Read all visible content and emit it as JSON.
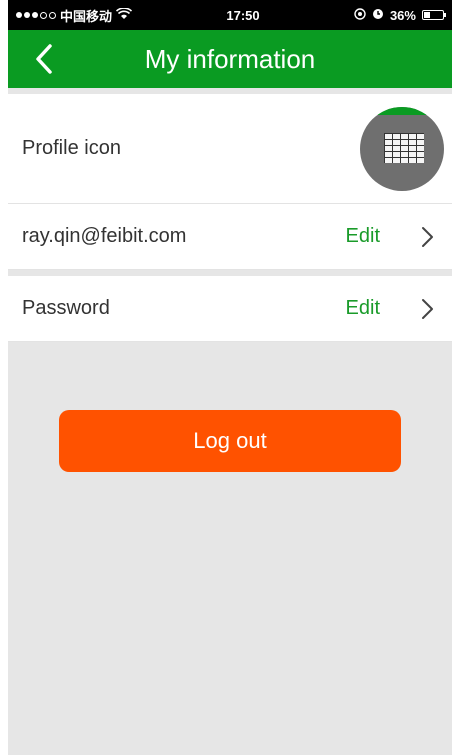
{
  "status_bar": {
    "carrier": "中国移动",
    "time": "17:50",
    "battery_text": "36%",
    "battery_level": 0.36
  },
  "nav": {
    "title": "My information",
    "back_icon": "chevron-left-icon"
  },
  "profile": {
    "label": "Profile icon"
  },
  "email_row": {
    "value": "ray.qin@feibit.com",
    "action_label": "Edit"
  },
  "password_row": {
    "label": "Password",
    "action_label": "Edit"
  },
  "logout": {
    "label": "Log out"
  },
  "colors": {
    "accent_green": "#0a9b22",
    "edit_text": "#1a9b2a",
    "logout_button": "#ff5200"
  }
}
